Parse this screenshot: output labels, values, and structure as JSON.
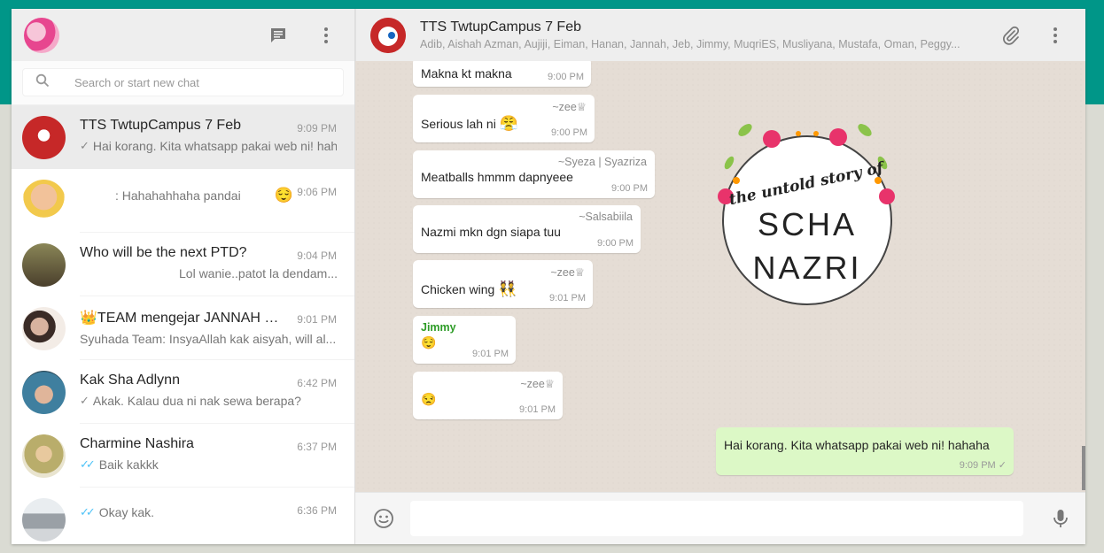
{
  "left": {
    "search_placeholder": "Search or start new chat",
    "chats": [
      {
        "name": "TTS TwtupCampus 7 Feb",
        "time": "9:09 PM",
        "preview": "Hai korang. Kita whatsapp pakai web ni! hahaha",
        "tick": "✓",
        "avatar_color": "#c62828"
      },
      {
        "name": "",
        "time": "9:06 PM",
        "preview": ": Hahahahhaha pandai",
        "emoji": "😌",
        "avatar_color": "#f2c94c"
      },
      {
        "name": "Who will be the next PTD?",
        "time": "9:04 PM",
        "preview": "Lol wanie..patot la dendam...",
        "avatar_color": "#6d6b4a"
      },
      {
        "name": "👑TEAM mengejar JANNAH ✨...",
        "time": "9:01 PM",
        "preview": "Syuhada Team: InsyaAllah kak aisyah, will al...",
        "avatar_color": "#a76f5a"
      },
      {
        "name": "Kak Sha Adlynn",
        "time": "6:42 PM",
        "preview": "Akak. Kalau dua ni nak sewa berapa?",
        "tick": "✓",
        "avatar_color": "#3f7f9f"
      },
      {
        "name": "Charmine Nashira",
        "time": "6:37 PM",
        "preview": "Baik kakkk",
        "tick": "✓✓",
        "avatar_color": "#c9b46b"
      },
      {
        "name": "",
        "time": "6:36 PM",
        "preview": "Okay kak.",
        "tick": "✓✓",
        "avatar_color": "#9aa0a6"
      }
    ]
  },
  "conversation": {
    "title": "TTS TwtupCampus 7 Feb",
    "members": "Adib, Aishah Azman, Aujiji, Eiman, Hanan, Jannah, Jeb, Jimmy, MuqriES, Musliyana, Mustafa, Oman, Peggy...",
    "messages": [
      {
        "sender": "",
        "text": "Makna kt makna",
        "time": "9:00 PM"
      },
      {
        "sender": "~zee♕",
        "text": "Serious lah ni",
        "emoji": "😤",
        "time": "9:00 PM"
      },
      {
        "sender": "~Syeza | Syazriza",
        "text": "Meatballs hmmm dapnyeee",
        "time": "9:00 PM"
      },
      {
        "sender": "~Salsabiila",
        "text": "Nazmi mkn dgn siapa tuu",
        "time": "9:00 PM"
      },
      {
        "sender": "~zee♕",
        "text": "Chicken wing",
        "emoji": "👯",
        "time": "9:01 PM"
      },
      {
        "sender": "Jimmy",
        "text": "",
        "emoji": "😌",
        "time": "9:01 PM"
      },
      {
        "sender": "~zee♕",
        "text": "",
        "emoji": "😒",
        "time": "9:01 PM"
      },
      {
        "sender": "",
        "text": "Hai korang. Kita whatsapp pakai web ni! hahaha",
        "time": "9:09 PM ✓"
      }
    ],
    "logo": {
      "line1": "the untold story of",
      "line2": "SCHA",
      "line3": "NAZRI"
    }
  },
  "colors": {
    "accent": "#009688",
    "outgoing": "#dcf8c6",
    "sender_green": "#2e9c27"
  }
}
